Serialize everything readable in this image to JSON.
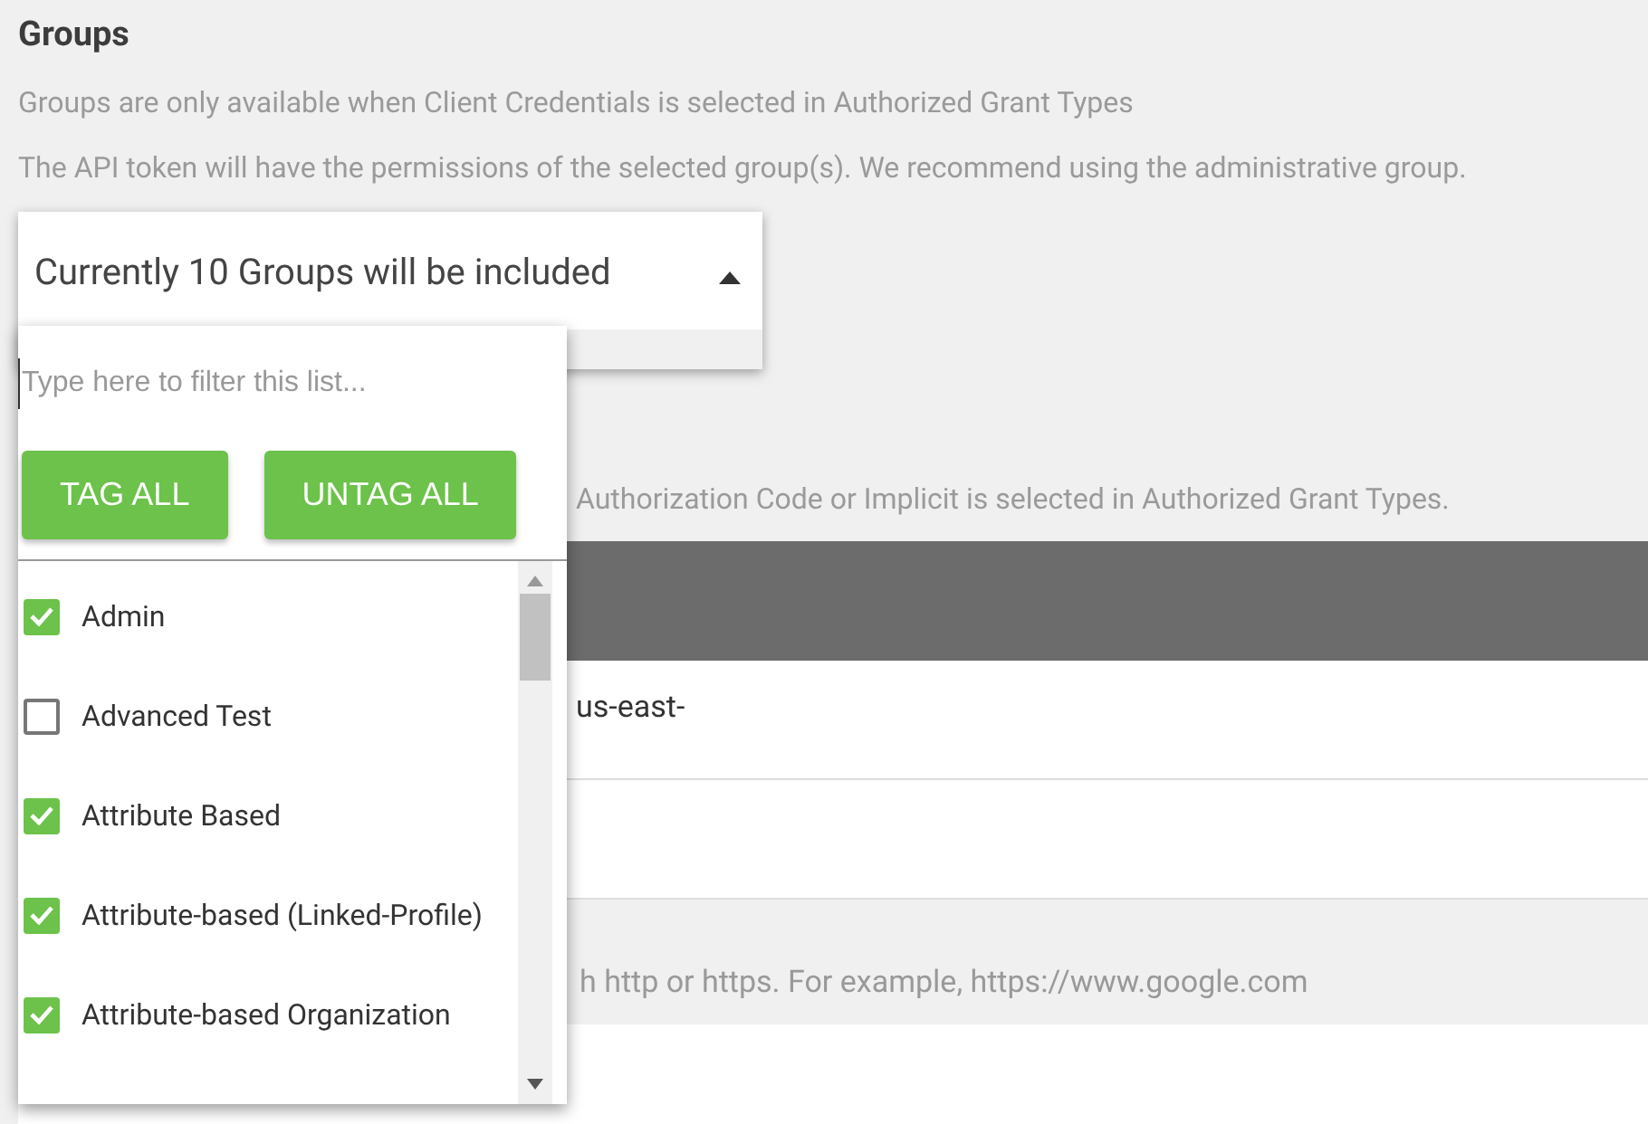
{
  "section": {
    "title": "Groups",
    "notes": [
      "Groups are only available when Client Credentials is selected in Authorized Grant Types",
      "The API token will have the permissions of the selected group(s). We recommend using the administrative group."
    ]
  },
  "dropdown": {
    "value": "Currently 10 Groups will be included",
    "expanded": true,
    "filter": {
      "placeholder": "Type here to filter this list..."
    },
    "buttons": [
      "TAG ALL",
      "UNTAG ALL"
    ],
    "items": [
      {
        "label": "Admin",
        "checked": true
      },
      {
        "label": "Advanced Test",
        "checked": false
      },
      {
        "label": "Attribute Based",
        "checked": true
      },
      {
        "label": "Attribute-based (Linked-Profile)",
        "checked": true
      },
      {
        "label": "Attribute-based Organization",
        "checked": true
      }
    ]
  },
  "background": {
    "note": "Authorization Code or Implicit is selected in Authorized Grant Types.",
    "row_1": "us-east-",
    "hint": "h http or https. For example, https://www.google.com"
  }
}
